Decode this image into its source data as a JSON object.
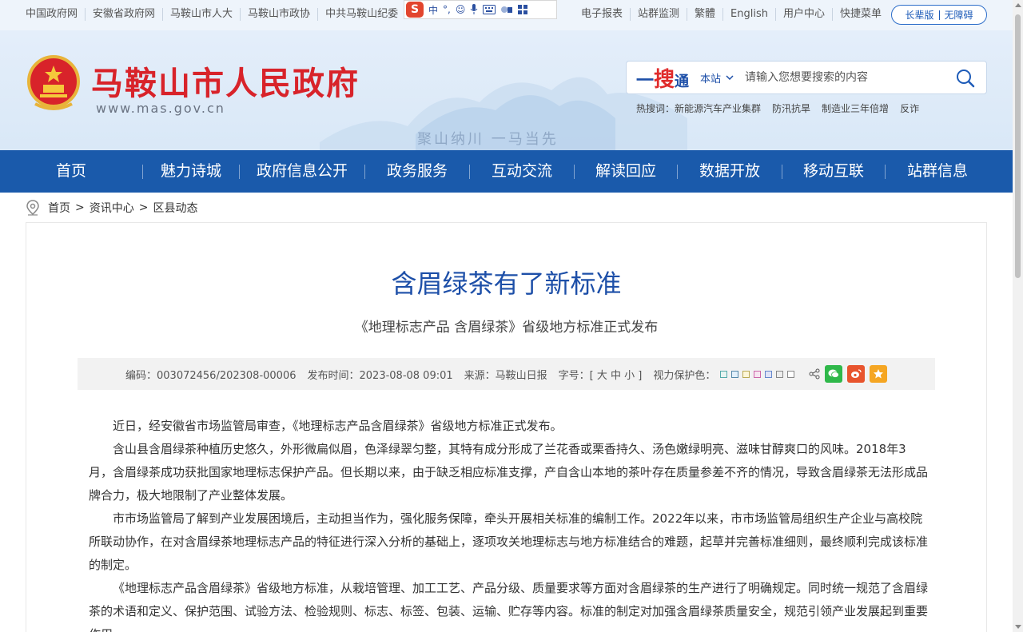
{
  "top_links_left": [
    "中国政府网",
    "安徽省政府网",
    "马鞍山市人大",
    "马鞍山市政协",
    "中共马鞍山纪委"
  ],
  "ime": {
    "logo": "S",
    "mode": "中"
  },
  "top_links_right": [
    "电子报表",
    "站群监测",
    "繁體",
    "English",
    "用户中心",
    "快捷菜单"
  ],
  "access_modes": [
    "长辈版",
    "无障碍"
  ],
  "site": {
    "name": "马鞍山市人民政府",
    "url": "www.mas.gov.cn",
    "slogan": "聚山纳川 一马当先"
  },
  "search": {
    "brand_1": "一",
    "brand_2": "搜",
    "brand_3": "通",
    "scope": "本站",
    "placeholder": "请输入您想要搜索的内容",
    "hotwords_label": "热搜词：",
    "hotwords": [
      "新能源汽车产业集群",
      "防汛抗旱",
      "制造业三年倍增",
      "反诈"
    ]
  },
  "nav": [
    "首页",
    "魅力诗城",
    "政府信息公开",
    "政务服务",
    "互动交流",
    "解读回应",
    "数据开放",
    "移动互联",
    "站群信息"
  ],
  "breadcrumb": [
    "首页",
    "资讯中心",
    "区县动态"
  ],
  "breadcrumb_sep": ">",
  "article": {
    "title": "含眉绿茶有了新标准",
    "subtitle": "《地理标志产品 含眉绿茶》省级地方标准正式发布",
    "meta": {
      "code": "编码：003072456/202308-00006",
      "date": "发布时间：2023-08-08 09:01",
      "source": "来源：马鞍山日报",
      "font_size": "字号：[ 大 中 小 ]",
      "eye_care": "视力保护色："
    },
    "swatch_colors": [
      "#e6f4f1",
      "#e2f0fb",
      "#fdf6d8",
      "#f7e4f0",
      "#dfe3f7",
      "#ededed",
      "#ffffff"
    ],
    "paragraphs": [
      "近日，经安徽省市场监管局审查，《地理标志产品含眉绿茶》省级地方标准正式发布。",
      "含山县含眉绿茶种植历史悠久，外形微扁似眉，色泽绿翠匀整，其特有成分形成了兰花香或栗香持久、汤色嫩绿明亮、滋味甘醇爽口的风味。2018年3月，含眉绿茶成功获批国家地理标志保护产品。但长期以来，由于缺乏相应标准支撑，产自含山本地的茶叶存在质量参差不齐的情况，导致含眉绿茶无法形成品牌合力，极大地限制了产业整体发展。",
      "市市场监管局了解到产业发展困境后，主动担当作为，强化服务保障，牵头开展相关标准的编制工作。2022年以来，市市场监管局组织生产企业与高校院所联动协作，在对含眉绿茶地理标志产品的特征进行深入分析的基础上，逐项攻关地理标志与地方标准结合的难题，起草并完善标准细则，最终顺利完成该标准的制定。",
      "《地理标志产品含眉绿茶》省级地方标准，从栽培管理、加工工艺、产品分级、质量要求等方面对含眉绿茶的生产进行了明确规定。同时统一规范了含眉绿茶的术语和定义、保护范围、试验方法、检验规则、标志、标签、包装、运输、贮存等内容。标准的制定对加强含眉绿茶质量安全，规范引领产业发展起到重要作用。"
    ]
  },
  "colors": {
    "nav_bg": "#1a5aab",
    "title": "#1d4fa8",
    "brand_red": "#d8232a"
  }
}
